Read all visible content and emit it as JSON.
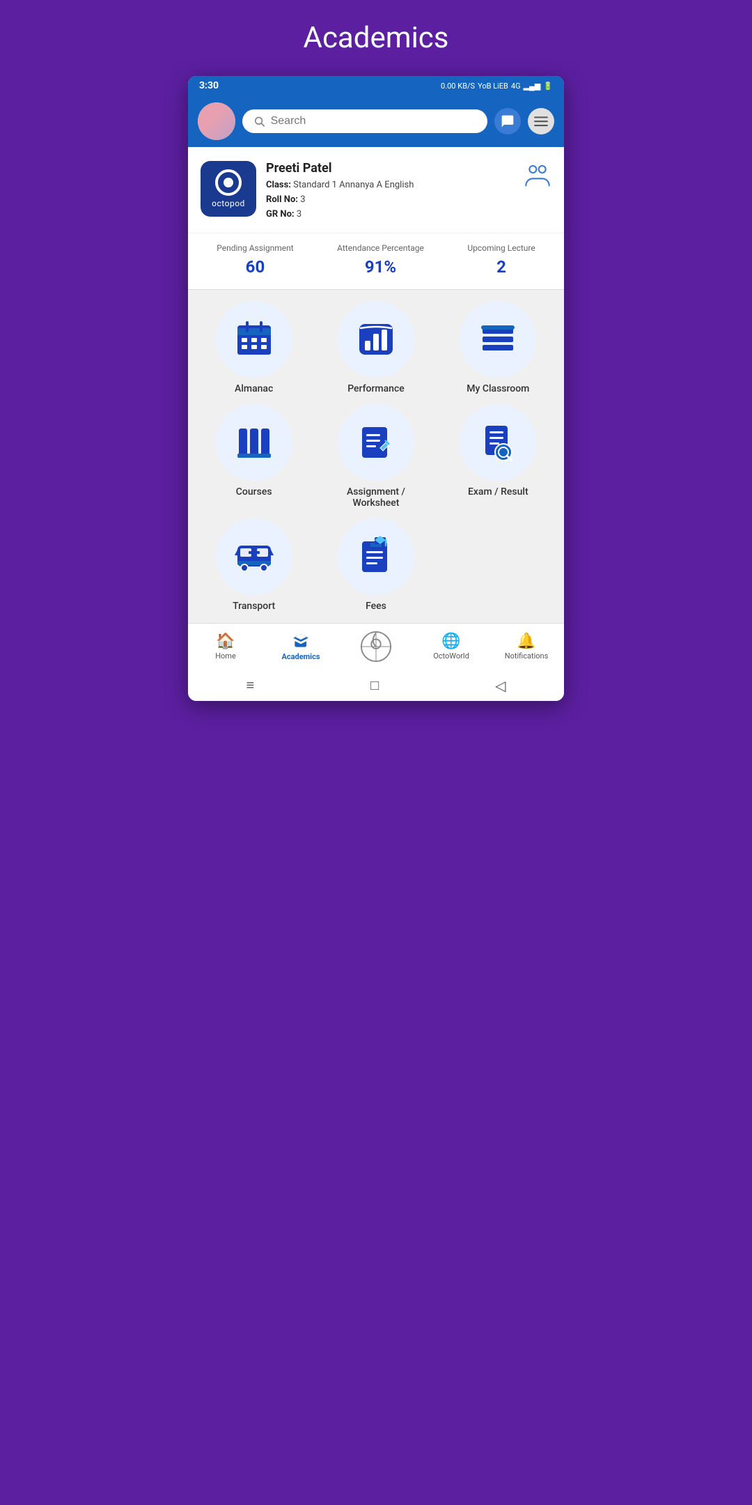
{
  "page": {
    "title": "Academics"
  },
  "statusBar": {
    "time": "3:30",
    "network": "0.00 KB/S",
    "sim": "YoB LiEB",
    "signal": "4G"
  },
  "topBar": {
    "searchPlaceholder": "Search",
    "searchIcon": "search"
  },
  "profile": {
    "logoText": "octopod",
    "name": "Preeti Patel",
    "classLabel": "Class:",
    "classValue": "Standard 1 Annanya A English",
    "rollLabel": "Roll No:",
    "rollValue": "3",
    "grLabel": "GR No:",
    "grValue": "3"
  },
  "stats": [
    {
      "label": "Pending Assignment",
      "value": "60"
    },
    {
      "label": "Attendance Percentage",
      "value": "91%"
    },
    {
      "label": "Upcoming Lecture",
      "value": "2"
    }
  ],
  "menuItems": [
    {
      "id": "almanac",
      "label": "Almanac",
      "icon": "calendar"
    },
    {
      "id": "performance",
      "label": "Performance",
      "icon": "chart"
    },
    {
      "id": "my-classroom",
      "label": "My Classroom",
      "icon": "classroom"
    },
    {
      "id": "courses",
      "label": "Courses",
      "icon": "books"
    },
    {
      "id": "assignment-worksheet",
      "label": "Assignment / Worksheet",
      "icon": "assignment"
    },
    {
      "id": "exam-result",
      "label": "Exam / Result",
      "icon": "exam"
    },
    {
      "id": "transport",
      "label": "Transport",
      "icon": "bus"
    },
    {
      "id": "fees",
      "label": "Fees",
      "icon": "fees"
    }
  ],
  "bottomNav": [
    {
      "id": "home",
      "label": "Home",
      "icon": "🏠",
      "active": false
    },
    {
      "id": "academics",
      "label": "Academics",
      "icon": "✏️",
      "active": true
    },
    {
      "id": "octoworld-center",
      "label": "",
      "icon": "⊕",
      "active": false
    },
    {
      "id": "octoworld",
      "label": "OctoWorld",
      "icon": "🌐",
      "active": false
    },
    {
      "id": "notifications",
      "label": "Notifications",
      "icon": "🔔",
      "active": false
    }
  ],
  "systemNav": {
    "menu": "≡",
    "home": "□",
    "back": "◁"
  }
}
